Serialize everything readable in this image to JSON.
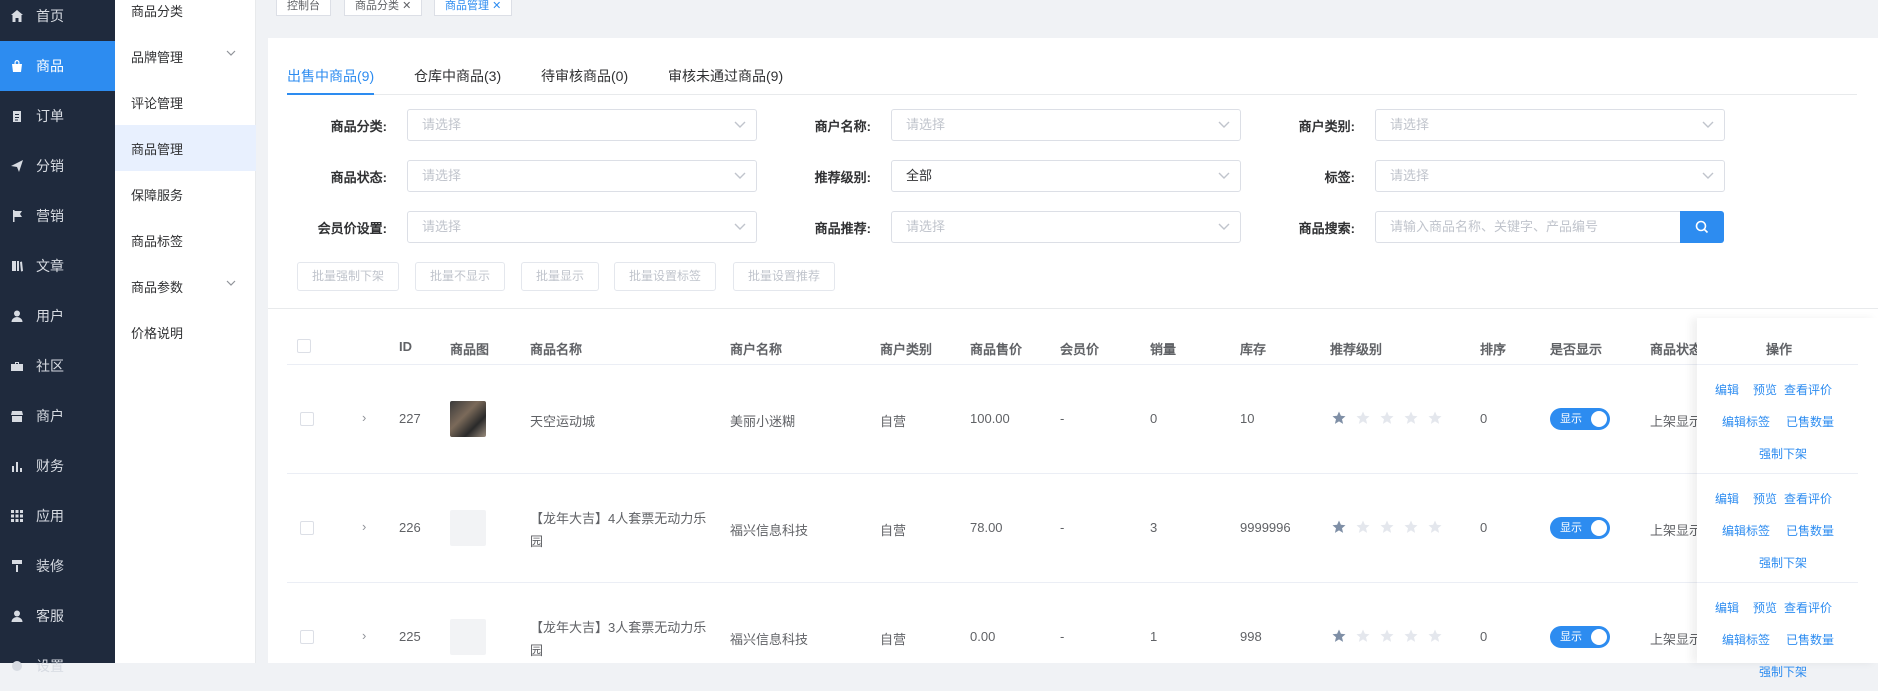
{
  "sidebar": {
    "items": [
      {
        "label": "首页",
        "icon": "home-icon"
      },
      {
        "label": "商品",
        "icon": "bag-icon",
        "active": true
      },
      {
        "label": "订单",
        "icon": "clipboard-icon"
      },
      {
        "label": "分销",
        "icon": "send-icon"
      },
      {
        "label": "营销",
        "icon": "flag-icon"
      },
      {
        "label": "文章",
        "icon": "book-icon"
      },
      {
        "label": "用户",
        "icon": "user-icon"
      },
      {
        "label": "社区",
        "icon": "briefcase-icon"
      },
      {
        "label": "商户",
        "icon": "store-icon"
      },
      {
        "label": "财务",
        "icon": "bar-chart-icon"
      },
      {
        "label": "应用",
        "icon": "grid-icon"
      },
      {
        "label": "装修",
        "icon": "paint-roller-icon"
      },
      {
        "label": "客服",
        "icon": "headset-icon"
      },
      {
        "label": "设置",
        "icon": "gear-icon"
      }
    ]
  },
  "submenu": {
    "items": [
      {
        "label": "商品分类"
      },
      {
        "label": "品牌管理",
        "expandable": true
      },
      {
        "label": "评论管理"
      },
      {
        "label": "商品管理",
        "active": true
      },
      {
        "label": "保障服务"
      },
      {
        "label": "商品标签"
      },
      {
        "label": "商品参数",
        "expandable": true
      },
      {
        "label": "价格说明"
      }
    ]
  },
  "page_tabs": [
    {
      "label": "控制台"
    },
    {
      "label": "商品分类"
    },
    {
      "label": "商品管理",
      "active": true
    }
  ],
  "content_tabs": [
    {
      "label": "出售中商品(9)",
      "active": true
    },
    {
      "label": "仓库中商品(3)"
    },
    {
      "label": "待审核商品(0)"
    },
    {
      "label": "审核未通过商品(9)"
    }
  ],
  "filters": {
    "category": {
      "label": "商品分类:",
      "placeholder": "请选择"
    },
    "merchant_name": {
      "label": "商户名称:",
      "placeholder": "请选择"
    },
    "merchant_type": {
      "label": "商户类别:",
      "placeholder": "请选择"
    },
    "status": {
      "label": "商品状态:",
      "placeholder": "请选择"
    },
    "recommend_level": {
      "label": "推荐级别:",
      "value": "全部"
    },
    "tag": {
      "label": "标签:",
      "placeholder": "请选择"
    },
    "member_price": {
      "label": "会员价设置:",
      "placeholder": "请选择"
    },
    "recommend": {
      "label": "商品推荐:",
      "placeholder": "请选择"
    },
    "search": {
      "label": "商品搜索:",
      "placeholder": "请输入商品名称、关键字、产品编号"
    }
  },
  "batch_buttons": [
    "批量强制下架",
    "批量不显示",
    "批量显示",
    "批量设置标签",
    "批量设置推荐"
  ],
  "table": {
    "headers": {
      "id": "ID",
      "image": "商品图",
      "name": "商品名称",
      "merchant": "商户名称",
      "merchant_type": "商户类别",
      "price": "商品售价",
      "member_price": "会员价",
      "sales": "销量",
      "stock": "库存",
      "level": "推荐级别",
      "sort": "排序",
      "display": "是否显示",
      "status": "商品状态",
      "actions": "操作"
    },
    "rows": [
      {
        "id": "227",
        "name": "天空运动城",
        "name2": "",
        "merchant": "美丽小迷糊",
        "merchant_type": "自营",
        "price": "100.00",
        "member_price": "-",
        "sales": "0",
        "stock": "10",
        "rating": 1,
        "sort": "0",
        "display": "显示",
        "status": "上架显示",
        "has_photo": true
      },
      {
        "id": "226",
        "name": "【龙年大吉】4人套票无动力乐",
        "name2": "园",
        "merchant": "福兴信息科技",
        "merchant_type": "自营",
        "price": "78.00",
        "member_price": "-",
        "sales": "3",
        "stock": "9999996",
        "rating": 1,
        "sort": "0",
        "display": "显示",
        "status": "上架显示",
        "has_photo": false
      },
      {
        "id": "225",
        "name": "【龙年大吉】3人套票无动力乐",
        "name2": "园",
        "merchant": "福兴信息科技",
        "merchant_type": "自营",
        "price": "0.00",
        "member_price": "-",
        "sales": "1",
        "stock": "998",
        "rating": 1,
        "sort": "0",
        "display": "显示",
        "status": "上架显示",
        "has_photo": false
      }
    ],
    "actions": {
      "edit": "编辑",
      "preview": "预览",
      "reviews": "查看评价",
      "edit_tags": "编辑标签",
      "sold_count": "已售数量",
      "force_off": "强制下架"
    }
  },
  "colors": {
    "accent": "#2d8cf0",
    "sidebar_bg": "#1f2a3d"
  }
}
